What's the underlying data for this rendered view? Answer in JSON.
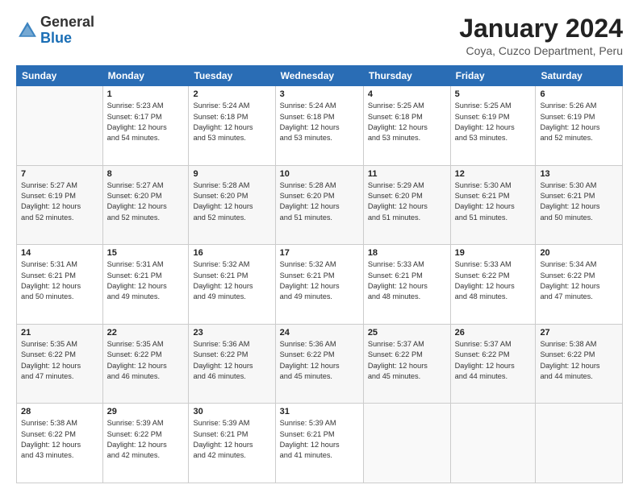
{
  "logo": {
    "general": "General",
    "blue": "Blue"
  },
  "header": {
    "title": "January 2024",
    "subtitle": "Coya, Cuzco Department, Peru"
  },
  "days_of_week": [
    "Sunday",
    "Monday",
    "Tuesday",
    "Wednesday",
    "Thursday",
    "Friday",
    "Saturday"
  ],
  "weeks": [
    [
      {
        "day": "",
        "info": ""
      },
      {
        "day": "1",
        "info": "Sunrise: 5:23 AM\nSunset: 6:17 PM\nDaylight: 12 hours\nand 54 minutes."
      },
      {
        "day": "2",
        "info": "Sunrise: 5:24 AM\nSunset: 6:18 PM\nDaylight: 12 hours\nand 53 minutes."
      },
      {
        "day": "3",
        "info": "Sunrise: 5:24 AM\nSunset: 6:18 PM\nDaylight: 12 hours\nand 53 minutes."
      },
      {
        "day": "4",
        "info": "Sunrise: 5:25 AM\nSunset: 6:18 PM\nDaylight: 12 hours\nand 53 minutes."
      },
      {
        "day": "5",
        "info": "Sunrise: 5:25 AM\nSunset: 6:19 PM\nDaylight: 12 hours\nand 53 minutes."
      },
      {
        "day": "6",
        "info": "Sunrise: 5:26 AM\nSunset: 6:19 PM\nDaylight: 12 hours\nand 52 minutes."
      }
    ],
    [
      {
        "day": "7",
        "info": "Sunrise: 5:27 AM\nSunset: 6:19 PM\nDaylight: 12 hours\nand 52 minutes."
      },
      {
        "day": "8",
        "info": "Sunrise: 5:27 AM\nSunset: 6:20 PM\nDaylight: 12 hours\nand 52 minutes."
      },
      {
        "day": "9",
        "info": "Sunrise: 5:28 AM\nSunset: 6:20 PM\nDaylight: 12 hours\nand 52 minutes."
      },
      {
        "day": "10",
        "info": "Sunrise: 5:28 AM\nSunset: 6:20 PM\nDaylight: 12 hours\nand 51 minutes."
      },
      {
        "day": "11",
        "info": "Sunrise: 5:29 AM\nSunset: 6:20 PM\nDaylight: 12 hours\nand 51 minutes."
      },
      {
        "day": "12",
        "info": "Sunrise: 5:30 AM\nSunset: 6:21 PM\nDaylight: 12 hours\nand 51 minutes."
      },
      {
        "day": "13",
        "info": "Sunrise: 5:30 AM\nSunset: 6:21 PM\nDaylight: 12 hours\nand 50 minutes."
      }
    ],
    [
      {
        "day": "14",
        "info": "Sunrise: 5:31 AM\nSunset: 6:21 PM\nDaylight: 12 hours\nand 50 minutes."
      },
      {
        "day": "15",
        "info": "Sunrise: 5:31 AM\nSunset: 6:21 PM\nDaylight: 12 hours\nand 49 minutes."
      },
      {
        "day": "16",
        "info": "Sunrise: 5:32 AM\nSunset: 6:21 PM\nDaylight: 12 hours\nand 49 minutes."
      },
      {
        "day": "17",
        "info": "Sunrise: 5:32 AM\nSunset: 6:21 PM\nDaylight: 12 hours\nand 49 minutes."
      },
      {
        "day": "18",
        "info": "Sunrise: 5:33 AM\nSunset: 6:21 PM\nDaylight: 12 hours\nand 48 minutes."
      },
      {
        "day": "19",
        "info": "Sunrise: 5:33 AM\nSunset: 6:22 PM\nDaylight: 12 hours\nand 48 minutes."
      },
      {
        "day": "20",
        "info": "Sunrise: 5:34 AM\nSunset: 6:22 PM\nDaylight: 12 hours\nand 47 minutes."
      }
    ],
    [
      {
        "day": "21",
        "info": "Sunrise: 5:35 AM\nSunset: 6:22 PM\nDaylight: 12 hours\nand 47 minutes."
      },
      {
        "day": "22",
        "info": "Sunrise: 5:35 AM\nSunset: 6:22 PM\nDaylight: 12 hours\nand 46 minutes."
      },
      {
        "day": "23",
        "info": "Sunrise: 5:36 AM\nSunset: 6:22 PM\nDaylight: 12 hours\nand 46 minutes."
      },
      {
        "day": "24",
        "info": "Sunrise: 5:36 AM\nSunset: 6:22 PM\nDaylight: 12 hours\nand 45 minutes."
      },
      {
        "day": "25",
        "info": "Sunrise: 5:37 AM\nSunset: 6:22 PM\nDaylight: 12 hours\nand 45 minutes."
      },
      {
        "day": "26",
        "info": "Sunrise: 5:37 AM\nSunset: 6:22 PM\nDaylight: 12 hours\nand 44 minutes."
      },
      {
        "day": "27",
        "info": "Sunrise: 5:38 AM\nSunset: 6:22 PM\nDaylight: 12 hours\nand 44 minutes."
      }
    ],
    [
      {
        "day": "28",
        "info": "Sunrise: 5:38 AM\nSunset: 6:22 PM\nDaylight: 12 hours\nand 43 minutes."
      },
      {
        "day": "29",
        "info": "Sunrise: 5:39 AM\nSunset: 6:22 PM\nDaylight: 12 hours\nand 42 minutes."
      },
      {
        "day": "30",
        "info": "Sunrise: 5:39 AM\nSunset: 6:21 PM\nDaylight: 12 hours\nand 42 minutes."
      },
      {
        "day": "31",
        "info": "Sunrise: 5:39 AM\nSunset: 6:21 PM\nDaylight: 12 hours\nand 41 minutes."
      },
      {
        "day": "",
        "info": ""
      },
      {
        "day": "",
        "info": ""
      },
      {
        "day": "",
        "info": ""
      }
    ]
  ]
}
